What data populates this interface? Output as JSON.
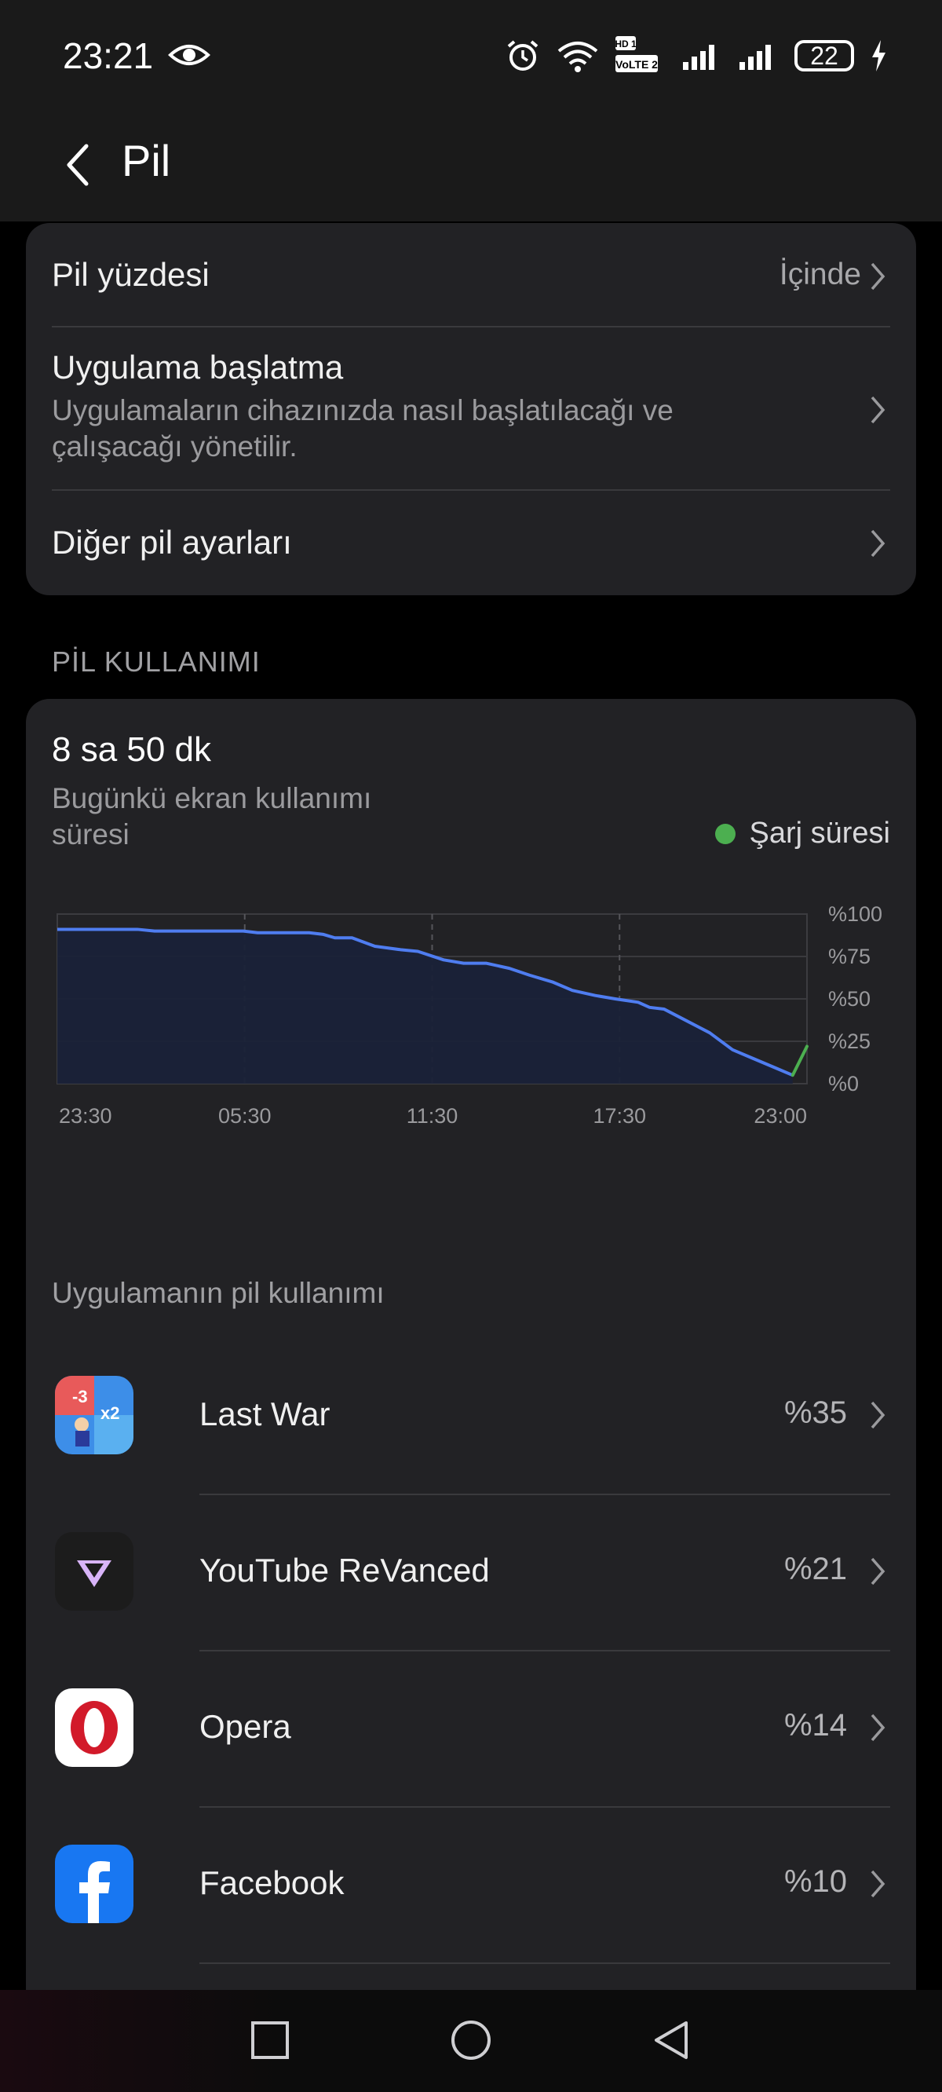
{
  "status_bar": {
    "time": "23:21",
    "battery_level": "22",
    "network_badges": [
      "HD 1",
      "VoLTE 2"
    ]
  },
  "app_bar": {
    "title": "Pil"
  },
  "settings": [
    {
      "title": "Pil yüzdesi",
      "value": "İçinde"
    },
    {
      "title": "Uygulama başlatma",
      "subtitle": "Uygulamaların cihazınızda nasıl başlatılacağı ve çalışacağı yönetilir."
    },
    {
      "title": "Diğer pil ayarları"
    }
  ],
  "section_header": "PİL KULLANIMI",
  "usage": {
    "screen_time": "8 sa 50 dk",
    "screen_time_label": "Bugünkü ekran kullanımı süresi",
    "legend_charge": "Şarj süresi"
  },
  "chart_data": {
    "type": "area",
    "x_ticks": [
      "23:30",
      "05:30",
      "11:30",
      "17:30",
      "23:00"
    ],
    "y_ticks": [
      "%100",
      "%75",
      "%50",
      "%25",
      "%0"
    ],
    "ylim": [
      0,
      100
    ],
    "xlim_hours": [
      0,
      24
    ],
    "series": [
      {
        "values": [
          [
            0,
            91
          ],
          [
            2.8,
            91
          ],
          [
            3.4,
            90
          ],
          [
            6.5,
            90
          ],
          [
            7.0,
            89
          ],
          [
            8.8,
            89
          ],
          [
            9.3,
            88
          ],
          [
            9.7,
            86
          ],
          [
            10.3,
            86
          ],
          [
            11.1,
            81
          ],
          [
            12.0,
            79
          ],
          [
            12.6,
            78
          ],
          [
            13.5,
            73
          ],
          [
            14.2,
            71
          ],
          [
            15.0,
            71
          ],
          [
            15.8,
            68
          ],
          [
            16.5,
            64
          ],
          [
            17.3,
            60
          ],
          [
            18.0,
            55
          ],
          [
            18.8,
            52
          ],
          [
            19.5,
            50
          ],
          [
            20.3,
            48
          ],
          [
            20.7,
            45
          ],
          [
            21.2,
            44
          ],
          [
            22.0,
            37
          ],
          [
            22.8,
            30
          ],
          [
            23.6,
            20
          ],
          [
            24.3,
            15
          ],
          [
            25.0,
            10
          ],
          [
            25.7,
            5
          ]
        ]
      },
      {
        "values": [
          [
            25.7,
            5
          ],
          [
            26.2,
            22
          ]
        ]
      }
    ],
    "grid": true,
    "colors": {
      "discharge": "#4f7df0",
      "charge": "#4caf50",
      "fill": "#1a2238"
    }
  },
  "app_usage_title": "Uygulamanın pil kullanımı",
  "apps": [
    {
      "name": "Last War",
      "percent": "%35",
      "icon": "last-war-icon"
    },
    {
      "name": "YouTube ReVanced",
      "percent": "%21",
      "icon": "youtube-revanced-icon"
    },
    {
      "name": "Opera",
      "percent": "%14",
      "icon": "opera-icon"
    },
    {
      "name": "Facebook",
      "percent": "%10",
      "icon": "facebook-icon"
    }
  ],
  "colors": {
    "accent_blue": "#4f7df0",
    "accent_green": "#4caf50",
    "card_bg": "#222225"
  }
}
